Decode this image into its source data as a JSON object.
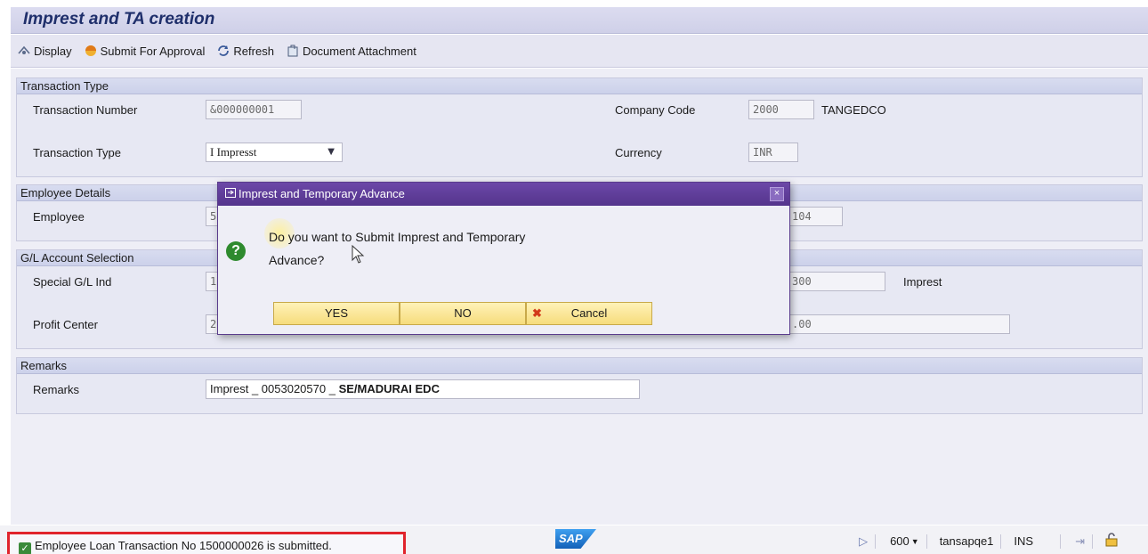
{
  "window": {
    "title": "Imprest and TA creation"
  },
  "toolbar": {
    "items": [
      {
        "label": "Display",
        "icon": "display-icon"
      },
      {
        "label": "Submit For Approval",
        "icon": "submit-icon"
      },
      {
        "label": "Refresh",
        "icon": "refresh-icon"
      },
      {
        "label": "Document Attachment",
        "icon": "attachment-icon"
      }
    ]
  },
  "transaction_group": {
    "title": "Transaction Type",
    "transaction_number_label": "Transaction Number",
    "transaction_number": "&000000001",
    "transaction_type_label": "Transaction Type",
    "transaction_type": "I Impresst",
    "company_code_label": "Company Code",
    "company_code": "2000",
    "company_name": "TANGEDCO",
    "currency_label": "Currency",
    "currency": "INR"
  },
  "employee_group": {
    "title": "Employee Details",
    "employee_label": "Employee",
    "employee_value_partial": "5",
    "right_value_partial": "104"
  },
  "gl_group": {
    "title": "G/L Account Selection",
    "special_gl_label": "Special G/L Ind",
    "special_gl_partial": "1",
    "right_value_partial": "300",
    "right_text": "Imprest",
    "profit_center_label": "Profit Center",
    "profit_center_partial": "2",
    "amount_partial": ".00"
  },
  "remarks_group": {
    "title": "Remarks",
    "remarks_label": "Remarks",
    "remarks_prefix": "Imprest _ 0053020570 _ ",
    "remarks_bold": "SE/MADURAI EDC"
  },
  "dialog": {
    "title": "Imprest and Temporary Advance",
    "close": "×",
    "message_line1": "Do you want to Submit Imprest and Temporary",
    "message_line2": "Advance?",
    "yes_label": "YES",
    "no_label": "NO",
    "cancel_label": "Cancel"
  },
  "statusbar": {
    "message": "Employee Loan Transaction No 1500000026 is submitted.",
    "logo": "SAP",
    "client": "600",
    "server": "tansapqe1",
    "mode": "INS"
  },
  "colors": {
    "dialog_title": "#5b3a96",
    "button_yellow": "#f6dc7c",
    "status_highlight": "#e0242c"
  }
}
